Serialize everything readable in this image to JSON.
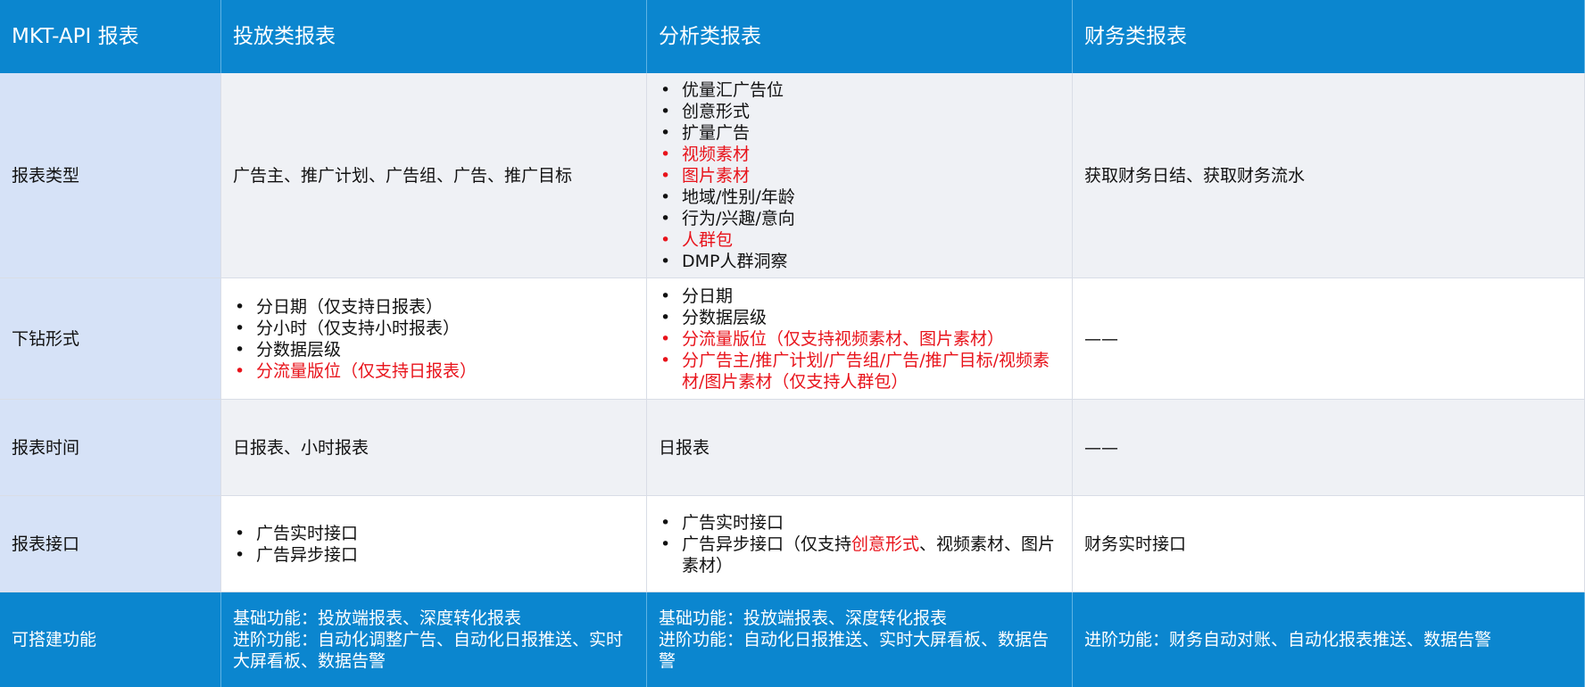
{
  "colors": {
    "header_bg": "#0b86cf",
    "label_bg": "#d6e2f7",
    "alt_bg": "#eff1f5",
    "highlight": "#e8131b"
  },
  "header": {
    "corner": "MKT-API 报表",
    "col1": "投放类报表",
    "col2": "分析类报表",
    "col3": "财务类报表"
  },
  "rows": {
    "report_type": {
      "label": "报表类型",
      "col1": "广告主、推广计划、广告组、广告、推广目标",
      "col2_items": [
        {
          "text": "优量汇广告位",
          "highlight": false
        },
        {
          "text": "创意形式",
          "highlight": false
        },
        {
          "text": "扩量广告",
          "highlight": false
        },
        {
          "text": "视频素材",
          "highlight": true
        },
        {
          "text": "图片素材",
          "highlight": true
        },
        {
          "text": "地域/性别/年龄",
          "highlight": false
        },
        {
          "text": "行为/兴趣/意向",
          "highlight": false
        },
        {
          "text": "人群包",
          "highlight": true
        },
        {
          "text": "DMP人群洞察",
          "highlight": false
        }
      ],
      "col3": "获取财务日结、获取财务流水"
    },
    "drill": {
      "label": "下钻形式",
      "col1_items": [
        {
          "text": "分日期（仅支持日报表）",
          "highlight": false
        },
        {
          "text": "分小时（仅支持小时报表）",
          "highlight": false
        },
        {
          "text": "分数据层级",
          "highlight": false
        },
        {
          "text": "分流量版位（仅支持日报表）",
          "highlight": true
        }
      ],
      "col2_items": [
        {
          "text": "分日期",
          "highlight": false
        },
        {
          "text": "分数据层级",
          "highlight": false
        },
        {
          "text": "分流量版位（仅支持视频素材、图片素材）",
          "highlight": true
        },
        {
          "text": "分广告主/推广计划/广告组/广告/推广目标/视频素材/图片素材（仅支持人群包）",
          "highlight": true
        }
      ],
      "col3": "——"
    },
    "time": {
      "label": "报表时间",
      "col1": "日报表、小时报表",
      "col2": "日报表",
      "col3": "——"
    },
    "interface": {
      "label": "报表接口",
      "col1_items": [
        {
          "text": "广告实时接口"
        },
        {
          "text": "广告异步接口"
        }
      ],
      "col2_item1": "广告实时接口",
      "col2_item2_prefix": "广告异步接口（仅支持",
      "col2_item2_red": "创意形式",
      "col2_item2_suffix": "、视频素材、图片素材）",
      "col3": "财务实时接口"
    },
    "features": {
      "label": "可搭建功能",
      "col1_line1": "基础功能：投放端报表、深度转化报表",
      "col1_line2": "进阶功能：自动化调整广告、自动化日报推送、实时大屏看板、数据告警",
      "col2_line1": "基础功能：投放端报表、深度转化报表",
      "col2_line2": "进阶功能：自动化日报推送、实时大屏看板、数据告警",
      "col3": "进阶功能：财务自动对账、自动化报表推送、数据告警"
    }
  }
}
